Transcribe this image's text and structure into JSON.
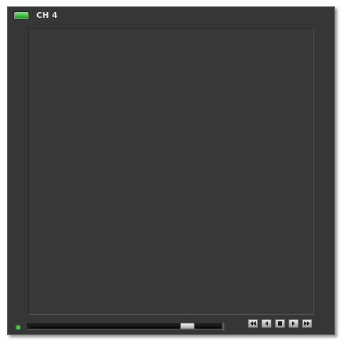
{
  "channel": {
    "title": "CH 4",
    "indicator_icon": "channel-active-led-icon",
    "indicator_color": "#3fcf3f"
  },
  "video": {
    "background_color": "#383838"
  },
  "status": {
    "led_icon": "status-led-icon",
    "led_color": "#34d834"
  },
  "seek": {
    "position_fraction": 0.84
  },
  "controls": [
    {
      "name": "rewind",
      "icon": "rewind-icon"
    },
    {
      "name": "previous",
      "icon": "step-back-icon"
    },
    {
      "name": "stop",
      "icon": "stop-icon"
    },
    {
      "name": "play",
      "icon": "play-icon"
    },
    {
      "name": "fast-forward",
      "icon": "fast-forward-icon"
    }
  ],
  "colors": {
    "panel": "#363636",
    "border": "#5a5a5a"
  }
}
